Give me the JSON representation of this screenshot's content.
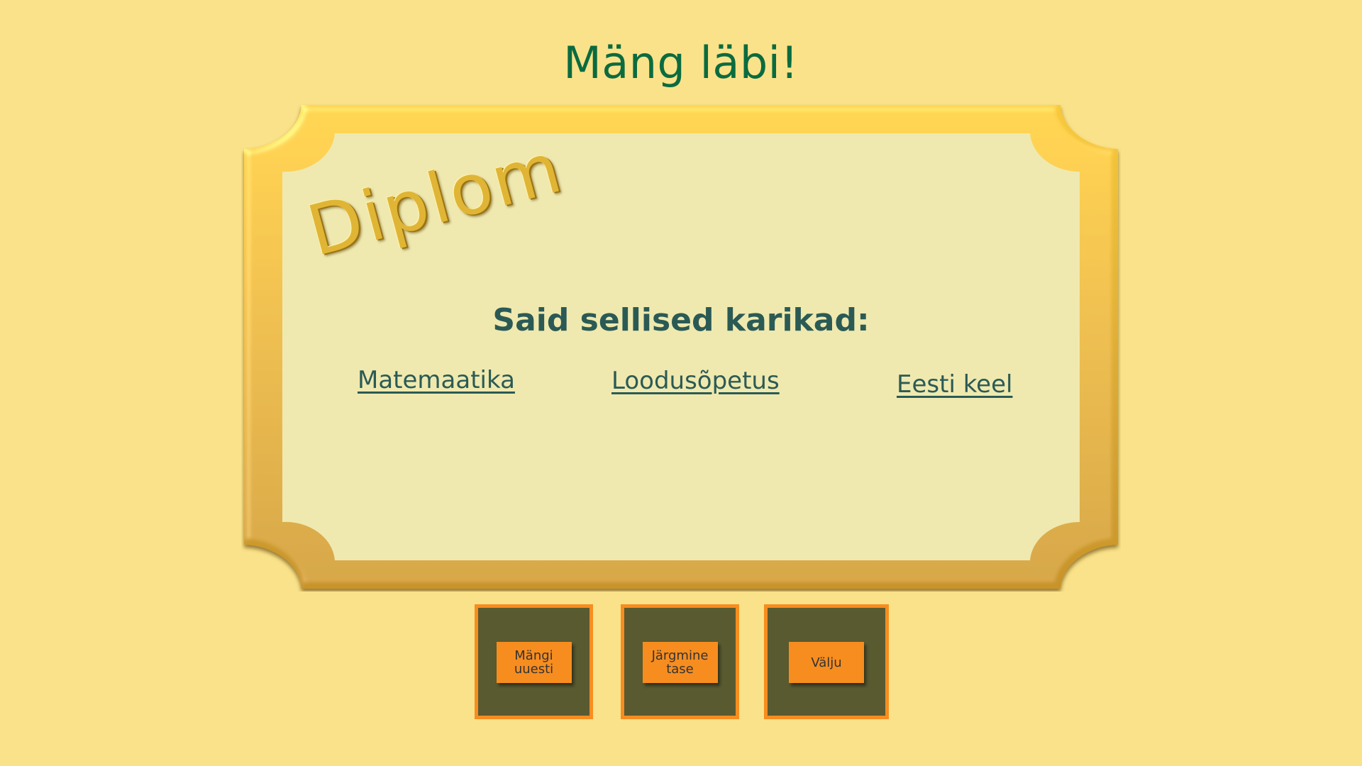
{
  "header": {
    "title": "Mäng läbi!"
  },
  "diploma": {
    "heading": "Diplom",
    "subtitle": "Said sellised karikad:",
    "trophies": [
      "Matemaatika",
      "Loodusõpetus",
      "Eesti keel"
    ]
  },
  "buttons": {
    "play_again": "Mängi\nuuesti",
    "next_level": "Järgmine\ntase",
    "exit": "Välju"
  },
  "colors": {
    "background": "#fae28a",
    "frame_gold": "#e0ae36",
    "paper": "#efe9af",
    "title": "#0b6b3f",
    "text": "#2b5a55",
    "button": "#f78d1f",
    "tile": "#595a30"
  }
}
